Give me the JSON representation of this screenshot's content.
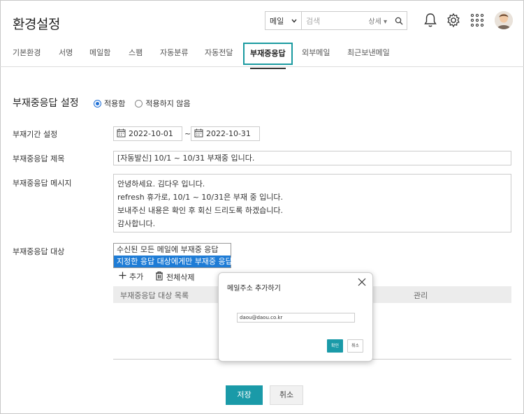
{
  "header": {
    "title": "환경설정",
    "search": {
      "scope": "메일",
      "placeholder": "검색",
      "detail_label": "상세 ▾"
    }
  },
  "tabs": [
    {
      "label": "기본환경"
    },
    {
      "label": "서명"
    },
    {
      "label": "메일함"
    },
    {
      "label": "스팸"
    },
    {
      "label": "자동분류"
    },
    {
      "label": "자동전달"
    },
    {
      "label": "부재중응답",
      "active": true
    },
    {
      "label": "외부메일"
    },
    {
      "label": "최근보낸메일"
    }
  ],
  "form": {
    "section_title": "부재중응답 설정",
    "radio_on": "적용함",
    "radio_off": "적용하지 않음",
    "period_label": "부재기간 설정",
    "start_date": "2022-10-01",
    "separator": "~",
    "end_date": "2022-10-31",
    "subject_label": "부재중응답 제목",
    "subject_value": "[자동발신] 10/1 ~ 10/31 부재중 입니다.",
    "message_label": "부재중응답 메시지",
    "message_lines": [
      "안녕하세요. 김다우 입니다.",
      "refresh 휴가로, 10/1 ~ 10/31은 부재 중 입니다.",
      "보내주신 내용은 확인 후 회신 드리도록 하겠습니다.",
      "감사합니다."
    ],
    "target_label": "부재중응답 대상",
    "target_options": [
      "수신된 모든 메일에 부재중 응답",
      "지정한 응답 대상에게만 부재중 응답"
    ],
    "add_label": "추가",
    "delete_all_label": "전체삭제",
    "table_col_target": "부재중응답 대상 목록",
    "table_col_manage": "관리",
    "save_label": "저장",
    "cancel_label": "취소"
  },
  "popup": {
    "title": "메일주소 추가하기",
    "input_value": "daou@daou.co.kr",
    "ok_label": "확인",
    "cancel_label": "취소"
  },
  "colors": {
    "accent": "#1a9aa8",
    "selection": "#1e7cd6"
  }
}
